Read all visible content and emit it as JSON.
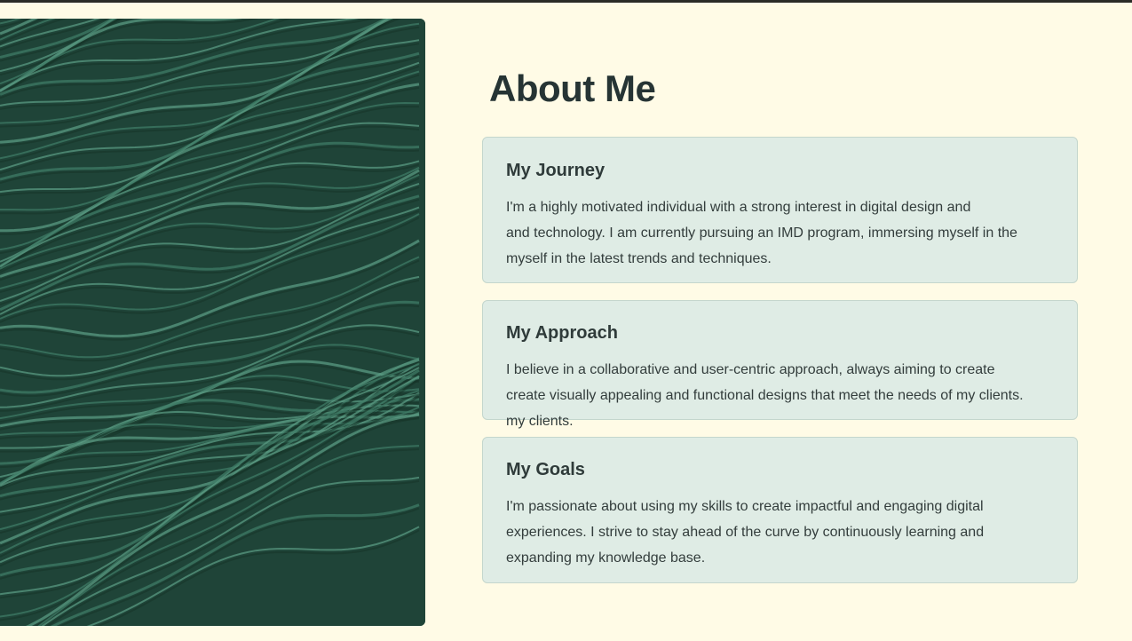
{
  "page": {
    "title": "About Me"
  },
  "image": {
    "name": "green-wavy-texture-image"
  },
  "cards": [
    {
      "id": "journey",
      "heading": "My Journey",
      "lines": [
        "I'm a highly motivated individual with a strong interest in digital design and",
        "and technology. I am currently pursuing an IMD program, immersing myself in the",
        "myself in the latest trends and techniques."
      ]
    },
    {
      "id": "approach",
      "heading": "My Approach",
      "lines": [
        "I believe in a collaborative and user-centric approach, always aiming to create",
        "create visually appealing and functional designs that meet the needs of my clients.",
        "my clients."
      ]
    },
    {
      "id": "goals",
      "heading": "My Goals",
      "lines": [
        "I'm passionate about using my skills to create impactful and engaging digital",
        "experiences. I strive to stay ahead of the curve by continuously learning and",
        "expanding my knowledge base."
      ]
    }
  ],
  "colors": {
    "background": "#fffbe6",
    "card": "#dfece5",
    "heading": "#263434",
    "texture_dark": "#1f4438",
    "texture_light": "#5a9a82"
  }
}
